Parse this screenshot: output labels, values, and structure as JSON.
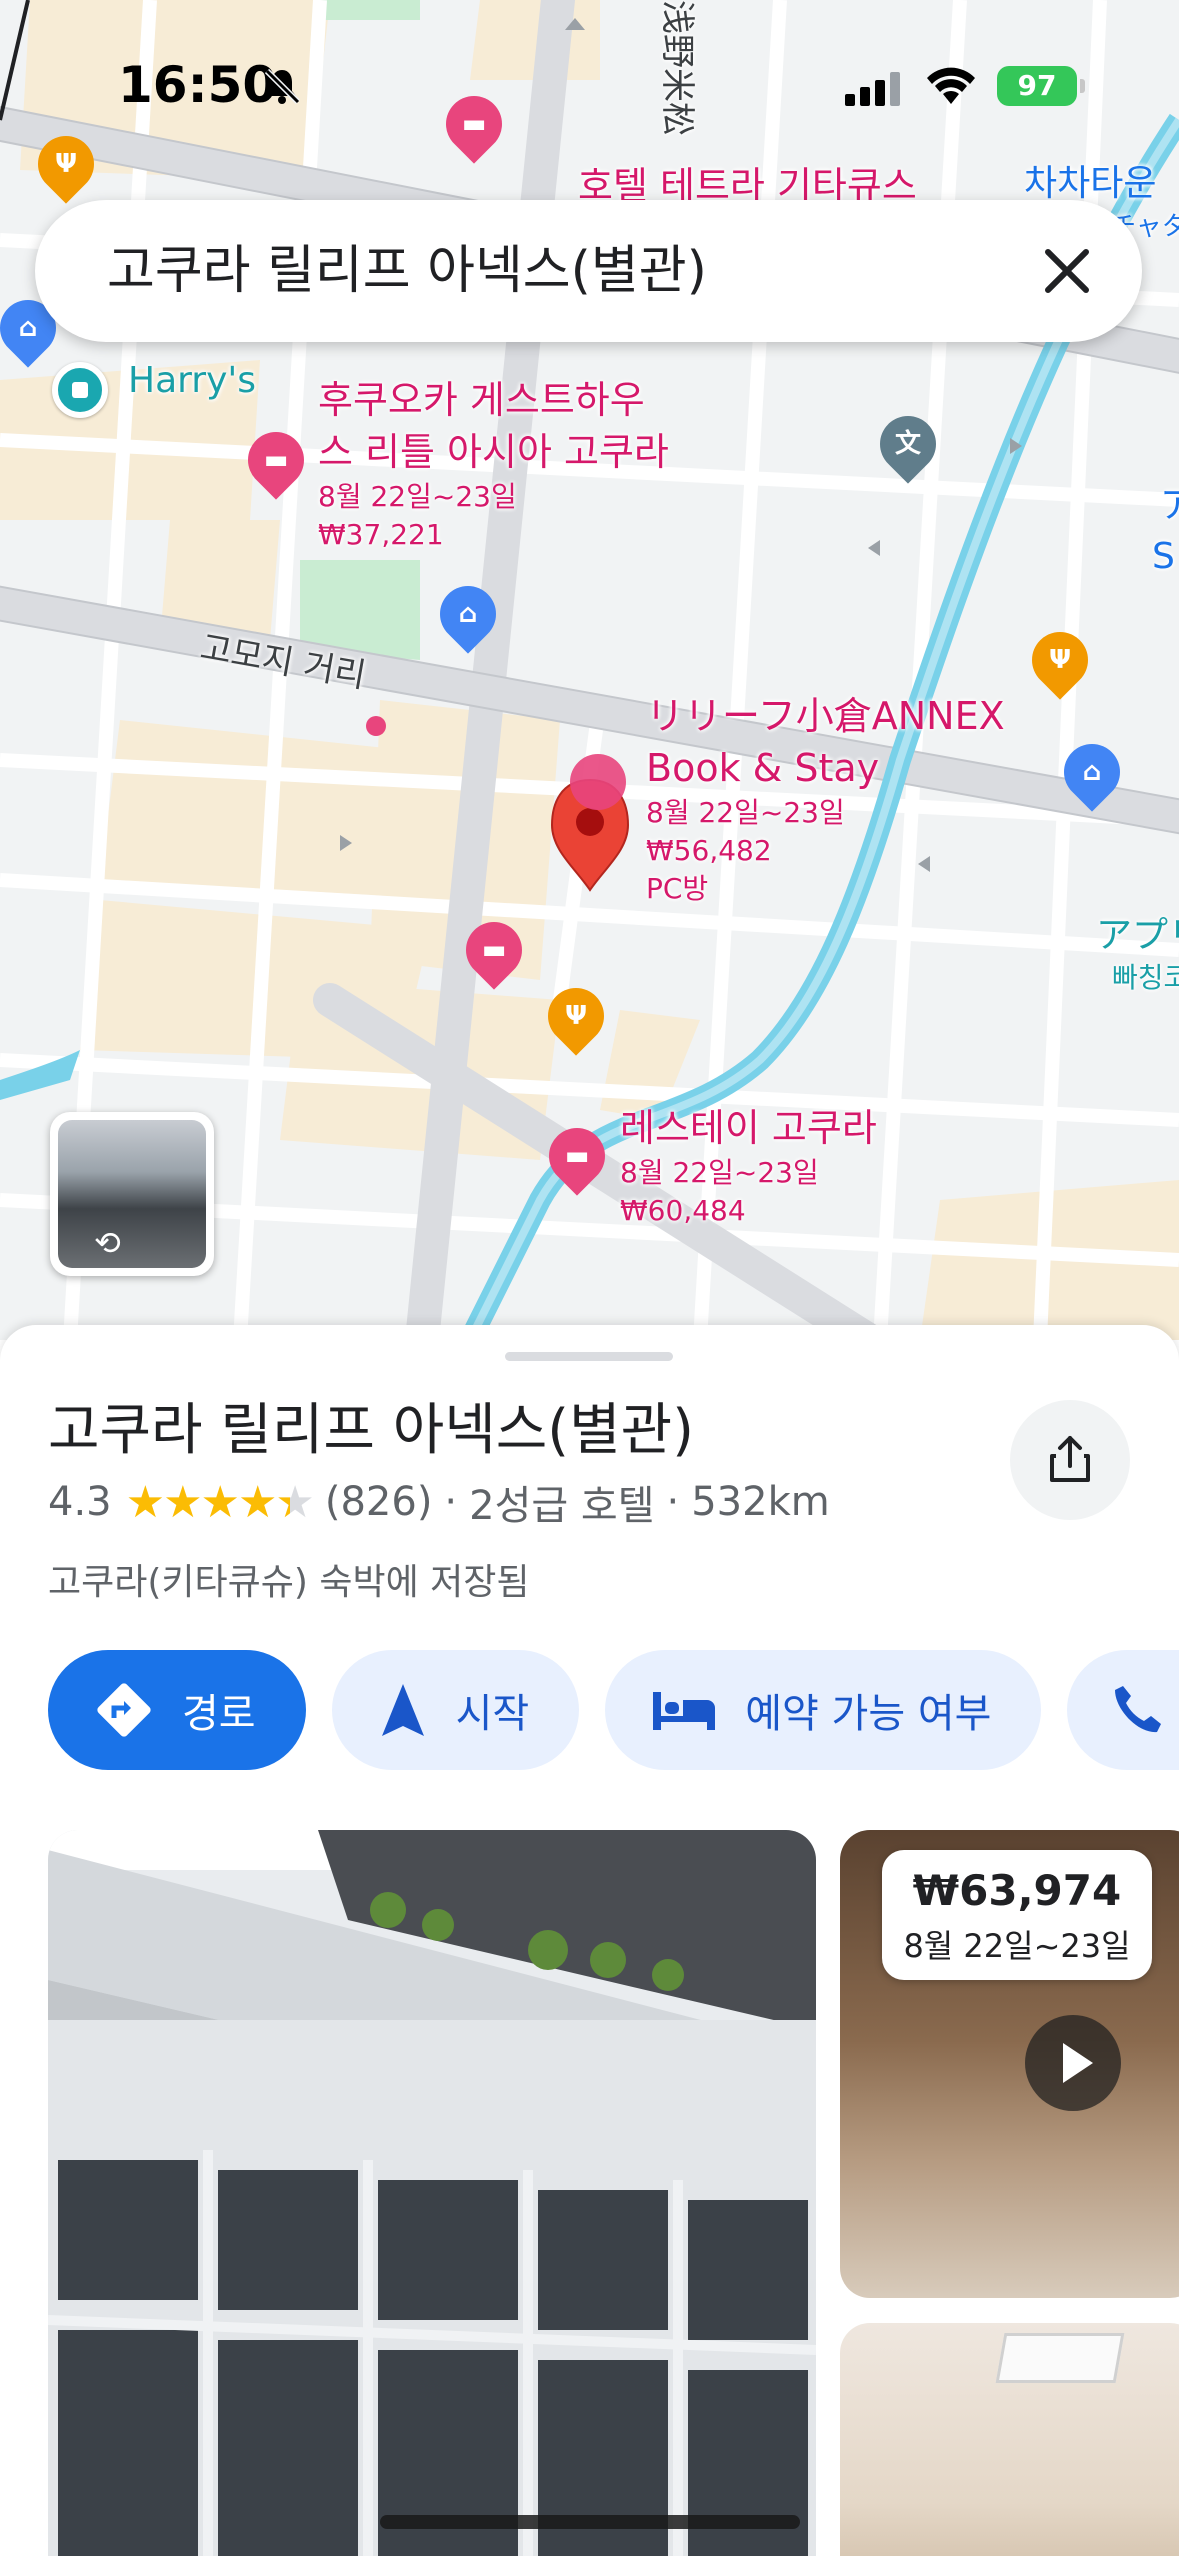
{
  "status_bar": {
    "time": "16:50",
    "battery": "97"
  },
  "search": {
    "query": "고쿠라 릴리프 아넥스(별관)"
  },
  "map": {
    "labels": {
      "street_asano": "浅野米松",
      "street_gomoji": "고모지 거리",
      "hotel_top_partial": "호텔 테트라 기타큐스",
      "area_top_right": "차차타운",
      "area_top_right_jp": "チャタ",
      "harrys": "Harry's",
      "right_edge_a": "ア",
      "right_edge_s": "S",
      "right_apple": "アプリ",
      "right_bakery": "빠칭코",
      "pc_room": "PC방"
    },
    "hotels": [
      {
        "name_line1": "후쿠오카 게스트하우",
        "name_line2": "스 리틀 아시아 고쿠라",
        "dates": "8월 22일~23일",
        "price": "₩37,221"
      },
      {
        "name_line1": "リリーフ小倉ANNEX",
        "name_line2": "Book & Stay",
        "dates": "8월 22일~23일",
        "price": "₩56,482"
      },
      {
        "name_line1": "레스테이 고쿠라",
        "dates": "8월 22일~23일",
        "price": "₩60,484"
      }
    ]
  },
  "place": {
    "title": "고쿠라 릴리프 아넥스(별관)",
    "rating": "4.3",
    "stars_value": 4.3,
    "review_count": "(826)",
    "category": "2성급 호텔",
    "distance": "532km",
    "saved_in": "고쿠라(키타큐슈) 숙박에 저장됨"
  },
  "actions": {
    "directions": "경로",
    "start": "시작",
    "availability": "예약 가능 여부"
  },
  "photos": {
    "price": "₩63,974",
    "dates": "8월 22일~23일"
  },
  "colors": {
    "accent": "#1a73e8",
    "hotel_pin": "#e8457d",
    "food_pin": "#f29900",
    "selected_pin": "#ea4335"
  }
}
